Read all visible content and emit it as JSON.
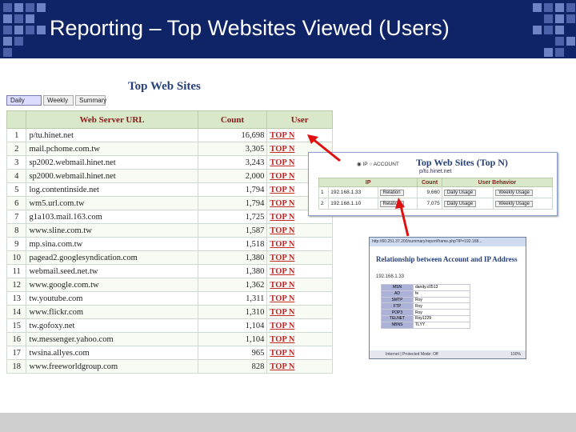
{
  "slide": {
    "title": "Reporting – Top Websites Viewed (Users)"
  },
  "report": {
    "heading": "Top Web Sites",
    "tabs": [
      "Daily",
      "Weekly",
      "Summary"
    ],
    "columns": [
      "Web Server URL",
      "Count",
      "User"
    ],
    "rows": [
      {
        "n": "1",
        "url": "p/tu.hinet.net",
        "count": "16,698",
        "user": "TOP N"
      },
      {
        "n": "2",
        "url": "mail.pchome.com.tw",
        "count": "3,305",
        "user": "TOP N"
      },
      {
        "n": "3",
        "url": "sp2002.webmail.hinet.net",
        "count": "3,243",
        "user": "TOP N"
      },
      {
        "n": "4",
        "url": "sp2000.webmail.hinet.net",
        "count": "2,000",
        "user": "TOP N"
      },
      {
        "n": "5",
        "url": "log.contentinside.net",
        "count": "1,794",
        "user": "TOP N"
      },
      {
        "n": "6",
        "url": "wm5.url.com.tw",
        "count": "1,794",
        "user": "TOP N"
      },
      {
        "n": "7",
        "url": "g1a103.mail.163.com",
        "count": "1,725",
        "user": "TOP N"
      },
      {
        "n": "8",
        "url": "www.sline.com.tw",
        "count": "1,587",
        "user": "TOP N"
      },
      {
        "n": "9",
        "url": "mp.sina.com.tw",
        "count": "1,518",
        "user": "TOP N"
      },
      {
        "n": "10",
        "url": "pagead2.googlesyndication.com",
        "count": "1,380",
        "user": "TOP N"
      },
      {
        "n": "11",
        "url": "webmail.seed.net.tw",
        "count": "1,380",
        "user": "TOP N"
      },
      {
        "n": "12",
        "url": "www.google.com.tw",
        "count": "1,362",
        "user": "TOP N"
      },
      {
        "n": "13",
        "url": "tw.youtube.com",
        "count": "1,311",
        "user": "TOP N"
      },
      {
        "n": "14",
        "url": "www.flickr.com",
        "count": "1,310",
        "user": "TOP N"
      },
      {
        "n": "15",
        "url": "tw.gofoxy.net",
        "count": "1,104",
        "user": "TOP N"
      },
      {
        "n": "16",
        "url": "tw.messenger.yahoo.com",
        "count": "1,104",
        "user": "TOP N"
      },
      {
        "n": "17",
        "url": "twsina.allyes.com",
        "count": "965",
        "user": "TOP N"
      },
      {
        "n": "18",
        "url": "www.freeworldgroup.com",
        "count": "828",
        "user": "TOP N"
      }
    ]
  },
  "popup_topn": {
    "heading": "Top Web Sites (Top N)",
    "radio_ip": "IP",
    "radio_account": "ACCOUNT",
    "subtitle": "p/tu.hinet.net",
    "columns": [
      "IP",
      "Count",
      "User Behavior"
    ],
    "rows": [
      {
        "n": "1",
        "ip": "192.168.1.33",
        "relation": "Relation",
        "count": "9,660",
        "daily": "Daily Usage",
        "weekly": "Weekly Usage"
      },
      {
        "n": "2",
        "ip": "192.168.1.10",
        "relation": "Relation",
        "count": "7,075",
        "daily": "Daily Usage",
        "weekly": "Weekly Usage"
      }
    ]
  },
  "popup_relation": {
    "address_bar": "http://60.251.37.200/summary/report/frame.php?IP=192.168...",
    "heading": "Relationship between Account and IP Address",
    "ip": "192.168.1.33",
    "rows": [
      {
        "k": "MSN",
        "v": "dandy.c0513"
      },
      {
        "k": "AD",
        "v": "fe"
      },
      {
        "k": "SMTP",
        "v": "Roy"
      },
      {
        "k": "FTP",
        "v": "Roy"
      },
      {
        "k": "POP3",
        "v": "Roy"
      },
      {
        "k": "TELNET",
        "v": "Roy1229"
      },
      {
        "k": "NBNS",
        "v": "TLYY"
      }
    ],
    "status": "Internet | Protected Mode: Off",
    "zoom": "100%"
  },
  "colors": {
    "banner": "#0f2466",
    "accent_red": "#c0282a",
    "header_green": "#d8e8c8"
  }
}
